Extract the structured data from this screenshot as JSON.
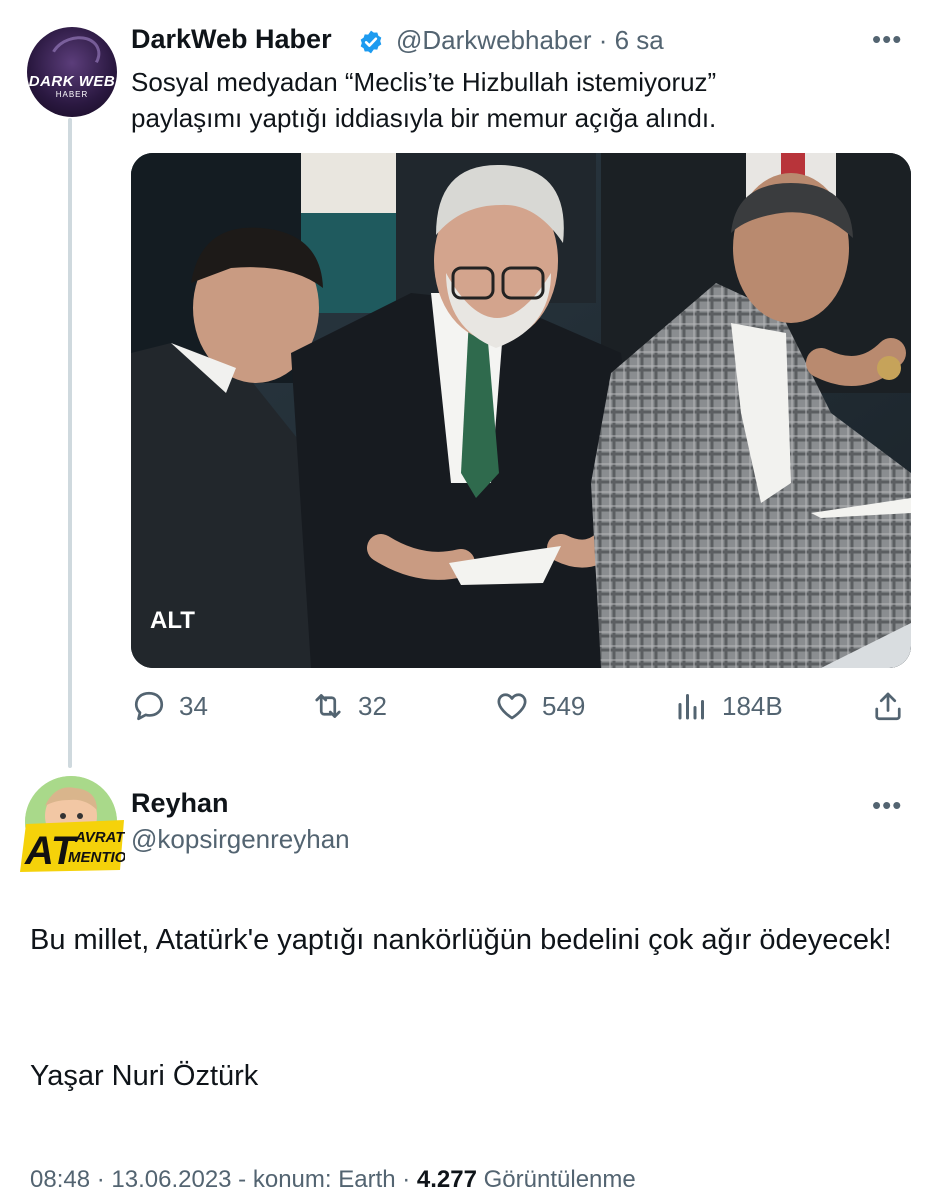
{
  "quoted_tweet": {
    "author_name": "DarkWeb Haber",
    "author_handle": "@Darkwebhaber",
    "time_ago": "6 sa",
    "avatar_text_top": "DARK WEB",
    "avatar_text_bottom": "HABER",
    "text_line1": "Sosyal medyadan “Meclis’te Hizbullah istemiyoruz”",
    "text_line2": "paylaşımı yaptığı iddiasıyla bir memur açığa alındı.",
    "media_alt_badge": "ALT",
    "actions": {
      "replies": "34",
      "retweets": "32",
      "likes": "549",
      "views": "184B"
    },
    "more_icon": "more-horizontal-icon"
  },
  "reply_tweet": {
    "author_name": "Reyhan",
    "author_handle": "@kopsirgenreyhan",
    "badge_text_big": "AT",
    "badge_text_small1": "AVRAT",
    "badge_text_small2": "MENTION",
    "body_line": "Bu millet, Atatürk'e yaptığı nankörlüğün bedelini çok ağır ödeyecek!",
    "body_signature": "Yaşar Nuri Öztürk",
    "meta_time": "08:48",
    "meta_date": "13.06.2023",
    "meta_location": "konum: Earth",
    "meta_views_count": "4.277",
    "meta_views_label": "Görüntülenme"
  },
  "colors": {
    "text_primary": "#0f1419",
    "text_secondary": "#536471",
    "verified_blue": "#1d9bf0",
    "thread_line": "#cfd9de"
  }
}
